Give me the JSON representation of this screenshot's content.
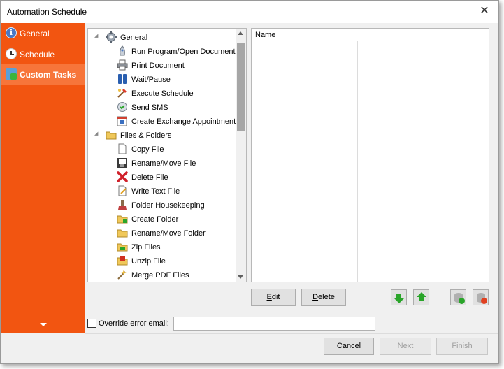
{
  "window": {
    "title": "Automation Schedule",
    "close_glyph": "✕"
  },
  "sidebar": {
    "items": [
      {
        "label": "General",
        "icon": "info-icon",
        "active": false
      },
      {
        "label": "Schedule",
        "icon": "clock-icon",
        "active": false
      },
      {
        "label": "Custom Tasks",
        "icon": "custom-tasks-icon",
        "active": true
      }
    ]
  },
  "task_tree": {
    "groups": [
      {
        "label": "General",
        "icon": "gear-icon",
        "children": [
          {
            "label": "Run Program/Open Document",
            "icon": "run-program-icon"
          },
          {
            "label": "Print Document",
            "icon": "printer-icon"
          },
          {
            "label": "Wait/Pause",
            "icon": "pause-icon"
          },
          {
            "label": "Execute Schedule",
            "icon": "execute-schedule-icon"
          },
          {
            "label": "Send SMS",
            "icon": "sms-icon"
          },
          {
            "label": "Create Exchange Appointment",
            "icon": "exchange-appointment-icon"
          }
        ]
      },
      {
        "label": "Files & Folders",
        "icon": "folder-icon",
        "children": [
          {
            "label": "Copy File",
            "icon": "copy-file-icon"
          },
          {
            "label": "Rename/Move File",
            "icon": "rename-file-icon"
          },
          {
            "label": "Delete File",
            "icon": "delete-x-icon"
          },
          {
            "label": "Write Text File",
            "icon": "write-text-icon"
          },
          {
            "label": "Folder Housekeeping",
            "icon": "housekeeping-icon"
          },
          {
            "label": "Create Folder",
            "icon": "create-folder-icon"
          },
          {
            "label": "Rename/Move Folder",
            "icon": "rename-folder-icon"
          },
          {
            "label": "Zip Files",
            "icon": "zip-icon"
          },
          {
            "label": "Unzip File",
            "icon": "unzip-icon"
          },
          {
            "label": "Merge PDF Files",
            "icon": "merge-pdf-icon"
          }
        ]
      }
    ]
  },
  "task_grid": {
    "columns": [
      "Name",
      ""
    ],
    "rows": []
  },
  "actions": {
    "edit": {
      "pre": "",
      "mnemonic": "E",
      "post": "dit"
    },
    "delete": {
      "pre": "",
      "mnemonic": "D",
      "post": "elete"
    }
  },
  "override": {
    "label": "Override error email:",
    "checked": false,
    "value": "",
    "placeholder": ""
  },
  "footer": {
    "cancel": {
      "pre": "",
      "mnemonic": "C",
      "post": "ancel"
    },
    "next": {
      "pre": "",
      "mnemonic": "N",
      "post": "ext"
    },
    "finish": {
      "pre": "",
      "mnemonic": "F",
      "post": "inish"
    }
  },
  "colors": {
    "sidebar": "#f25511",
    "sidebar_active": "#f7753a",
    "arrow_green": "#2aa52a",
    "window_bg": "#f0f0f0"
  }
}
